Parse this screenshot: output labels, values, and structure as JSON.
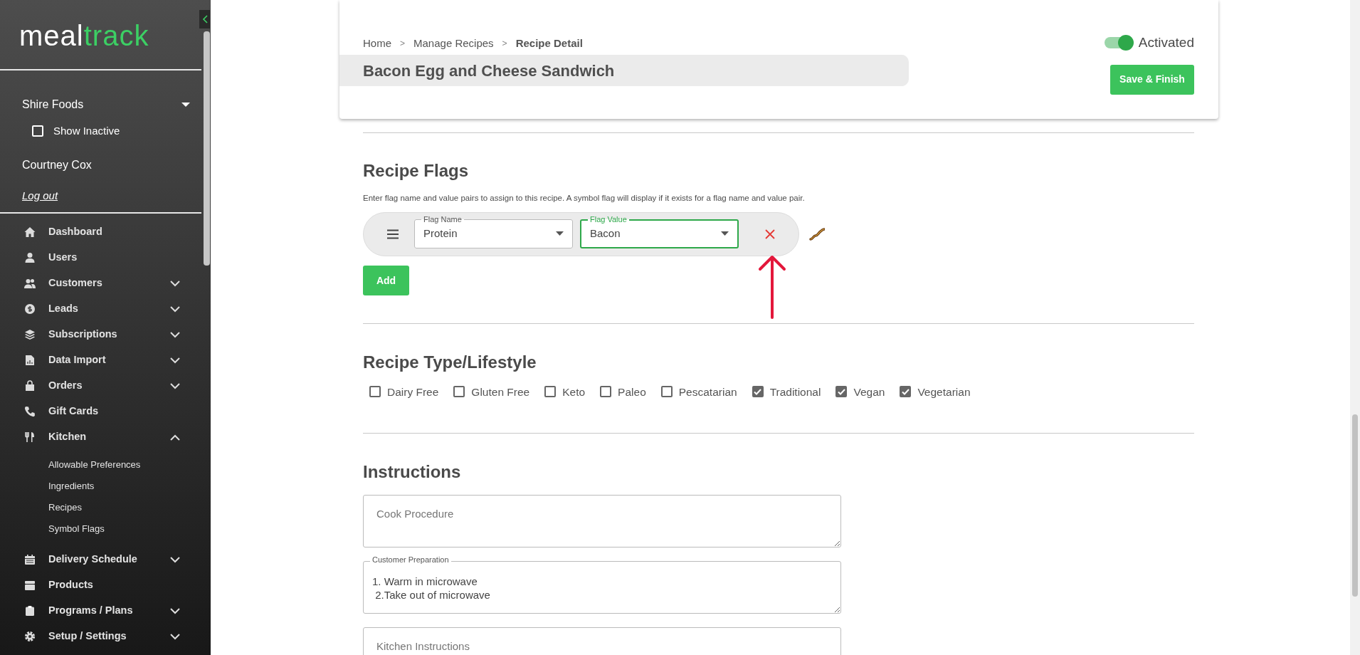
{
  "sidebar": {
    "logo": [
      "meal",
      "track"
    ],
    "company": {
      "name": "Shire Foods"
    },
    "show_inactive": {
      "label": "Show Inactive",
      "checked": false
    },
    "user": "Courtney Cox",
    "logout": "Log out",
    "nav": [
      {
        "label": "Dashboard"
      },
      {
        "label": "Users"
      },
      {
        "label": "Customers",
        "expanded": false
      },
      {
        "label": "Leads",
        "expanded": false
      },
      {
        "label": "Subscriptions",
        "expanded": false
      },
      {
        "label": "Data Import",
        "expanded": false
      },
      {
        "label": "Orders",
        "expanded": false
      },
      {
        "label": "Gift Cards"
      },
      {
        "label": "Kitchen",
        "expanded": true,
        "children": [
          {
            "label": "Allowable Preferences"
          },
          {
            "label": "Ingredients"
          },
          {
            "label": "Recipes"
          },
          {
            "label": "Symbol Flags"
          }
        ]
      },
      {
        "label": "Delivery Schedule",
        "expanded": false
      },
      {
        "label": "Products"
      },
      {
        "label": "Programs / Plans",
        "expanded": false
      },
      {
        "label": "Setup / Settings",
        "expanded": false
      }
    ]
  },
  "header": {
    "breadcrumb": {
      "separator": ">",
      "items": [
        {
          "label": "Home",
          "current": false
        },
        {
          "label": "Manage Recipes",
          "current": false
        },
        {
          "label": "Recipe Detail",
          "current": true
        }
      ]
    },
    "title": "Bacon Egg and Cheese Sandwich",
    "activated": {
      "label": "Activated",
      "on": true
    },
    "save_button": "Save & Finish"
  },
  "recipe_flags": {
    "heading": "Recipe Flags",
    "description": {
      "before": "Enter flag name and value pairs to assign to this recipe. A ",
      "link": "symbol flag",
      "after": " will display if it exists for a flag name and value pair."
    },
    "rows": [
      {
        "symbol_flag": true,
        "fields": [
          {
            "label": "Flag Name",
            "value": "Protein",
            "focused": false
          },
          {
            "label": "Flag Value",
            "value": "Bacon",
            "focused": true
          }
        ]
      }
    ],
    "add_button": "Add"
  },
  "recipe_type": {
    "heading": "Recipe Type/Lifestyle",
    "options": [
      {
        "label": "Dairy Free",
        "checked": false
      },
      {
        "label": "Gluten Free",
        "checked": false
      },
      {
        "label": "Keto",
        "checked": false
      },
      {
        "label": "Paleo",
        "checked": false
      },
      {
        "label": "Pescatarian",
        "checked": false
      },
      {
        "label": "Traditional",
        "checked": true
      },
      {
        "label": "Vegan",
        "checked": true
      },
      {
        "label": "Vegetarian",
        "checked": true
      }
    ]
  },
  "instructions": {
    "heading": "Instructions",
    "fields": [
      {
        "placeholder": "Cook Procedure"
      },
      {
        "label": "Customer Preparation",
        "value": "1. Warm in microwave\n 2.Take out of microwave"
      },
      {
        "placeholder": "Kitchen Instructions"
      }
    ]
  }
}
